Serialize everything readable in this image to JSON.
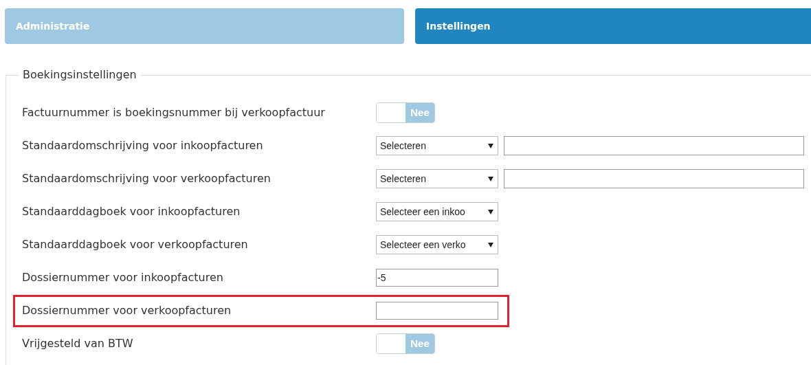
{
  "tabs": [
    {
      "label": "Administratie",
      "selected": false
    },
    {
      "label": "Instellingen",
      "selected": true
    }
  ],
  "section": {
    "legend": "Boekingsinstellingen",
    "rows": [
      {
        "kind": "toggle",
        "label": "Factuurnummer is boekingsnummer bij verkoopfactuur",
        "on": false,
        "toggle_label": "Nee",
        "highlighted": false
      },
      {
        "kind": "select_text",
        "label": "Standaardomschrijving voor inkoopfacturen",
        "select": "Selecteren",
        "highlighted": false
      },
      {
        "kind": "select_text",
        "label": "Standaardomschrijving voor verkoopfacturen",
        "select": "Selecteren",
        "highlighted": false
      },
      {
        "kind": "select",
        "label": "Standaarddagboek voor inkoopfacturen",
        "select": "Selecteer een inkoo",
        "highlighted": false
      },
      {
        "kind": "select",
        "label": "Standaarddagboek voor verkoopfacturen",
        "select": "Selecteer een verko",
        "highlighted": false
      },
      {
        "kind": "text",
        "label": "Dossiernummer voor inkoopfacturen",
        "value": "-5",
        "highlighted": false
      },
      {
        "kind": "text",
        "label": "Dossiernummer voor verkoopfacturen",
        "highlighted": true
      },
      {
        "kind": "toggle",
        "label": "Vrijgesteld van BTW",
        "on": false,
        "toggle_label": "Nee",
        "highlighted": false
      }
    ]
  }
}
